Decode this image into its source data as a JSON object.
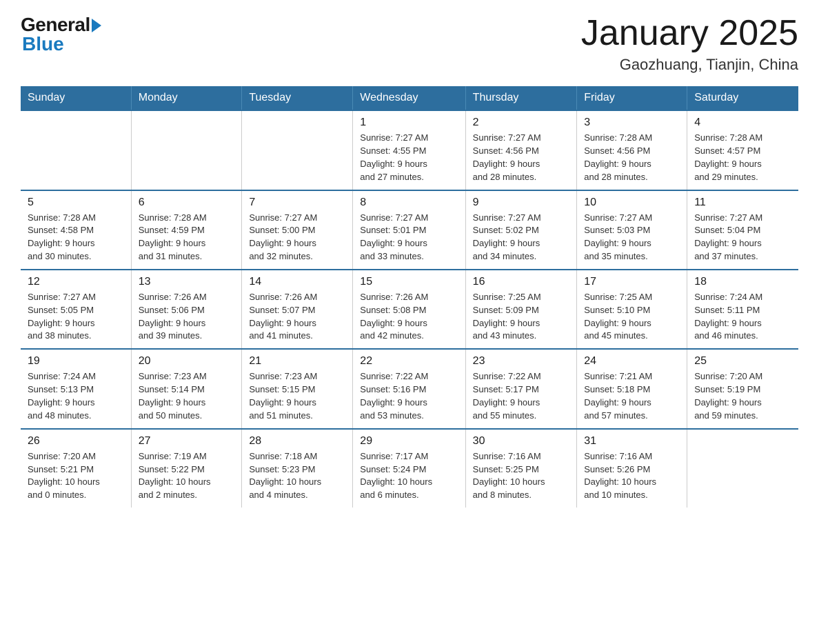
{
  "header": {
    "logo_general": "General",
    "logo_blue": "Blue",
    "month_title": "January 2025",
    "location": "Gaozhuang, Tianjin, China"
  },
  "days_of_week": [
    "Sunday",
    "Monday",
    "Tuesday",
    "Wednesday",
    "Thursday",
    "Friday",
    "Saturday"
  ],
  "weeks": [
    [
      {
        "day": "",
        "info": ""
      },
      {
        "day": "",
        "info": ""
      },
      {
        "day": "",
        "info": ""
      },
      {
        "day": "1",
        "info": "Sunrise: 7:27 AM\nSunset: 4:55 PM\nDaylight: 9 hours\nand 27 minutes."
      },
      {
        "day": "2",
        "info": "Sunrise: 7:27 AM\nSunset: 4:56 PM\nDaylight: 9 hours\nand 28 minutes."
      },
      {
        "day": "3",
        "info": "Sunrise: 7:28 AM\nSunset: 4:56 PM\nDaylight: 9 hours\nand 28 minutes."
      },
      {
        "day": "4",
        "info": "Sunrise: 7:28 AM\nSunset: 4:57 PM\nDaylight: 9 hours\nand 29 minutes."
      }
    ],
    [
      {
        "day": "5",
        "info": "Sunrise: 7:28 AM\nSunset: 4:58 PM\nDaylight: 9 hours\nand 30 minutes."
      },
      {
        "day": "6",
        "info": "Sunrise: 7:28 AM\nSunset: 4:59 PM\nDaylight: 9 hours\nand 31 minutes."
      },
      {
        "day": "7",
        "info": "Sunrise: 7:27 AM\nSunset: 5:00 PM\nDaylight: 9 hours\nand 32 minutes."
      },
      {
        "day": "8",
        "info": "Sunrise: 7:27 AM\nSunset: 5:01 PM\nDaylight: 9 hours\nand 33 minutes."
      },
      {
        "day": "9",
        "info": "Sunrise: 7:27 AM\nSunset: 5:02 PM\nDaylight: 9 hours\nand 34 minutes."
      },
      {
        "day": "10",
        "info": "Sunrise: 7:27 AM\nSunset: 5:03 PM\nDaylight: 9 hours\nand 35 minutes."
      },
      {
        "day": "11",
        "info": "Sunrise: 7:27 AM\nSunset: 5:04 PM\nDaylight: 9 hours\nand 37 minutes."
      }
    ],
    [
      {
        "day": "12",
        "info": "Sunrise: 7:27 AM\nSunset: 5:05 PM\nDaylight: 9 hours\nand 38 minutes."
      },
      {
        "day": "13",
        "info": "Sunrise: 7:26 AM\nSunset: 5:06 PM\nDaylight: 9 hours\nand 39 minutes."
      },
      {
        "day": "14",
        "info": "Sunrise: 7:26 AM\nSunset: 5:07 PM\nDaylight: 9 hours\nand 41 minutes."
      },
      {
        "day": "15",
        "info": "Sunrise: 7:26 AM\nSunset: 5:08 PM\nDaylight: 9 hours\nand 42 minutes."
      },
      {
        "day": "16",
        "info": "Sunrise: 7:25 AM\nSunset: 5:09 PM\nDaylight: 9 hours\nand 43 minutes."
      },
      {
        "day": "17",
        "info": "Sunrise: 7:25 AM\nSunset: 5:10 PM\nDaylight: 9 hours\nand 45 minutes."
      },
      {
        "day": "18",
        "info": "Sunrise: 7:24 AM\nSunset: 5:11 PM\nDaylight: 9 hours\nand 46 minutes."
      }
    ],
    [
      {
        "day": "19",
        "info": "Sunrise: 7:24 AM\nSunset: 5:13 PM\nDaylight: 9 hours\nand 48 minutes."
      },
      {
        "day": "20",
        "info": "Sunrise: 7:23 AM\nSunset: 5:14 PM\nDaylight: 9 hours\nand 50 minutes."
      },
      {
        "day": "21",
        "info": "Sunrise: 7:23 AM\nSunset: 5:15 PM\nDaylight: 9 hours\nand 51 minutes."
      },
      {
        "day": "22",
        "info": "Sunrise: 7:22 AM\nSunset: 5:16 PM\nDaylight: 9 hours\nand 53 minutes."
      },
      {
        "day": "23",
        "info": "Sunrise: 7:22 AM\nSunset: 5:17 PM\nDaylight: 9 hours\nand 55 minutes."
      },
      {
        "day": "24",
        "info": "Sunrise: 7:21 AM\nSunset: 5:18 PM\nDaylight: 9 hours\nand 57 minutes."
      },
      {
        "day": "25",
        "info": "Sunrise: 7:20 AM\nSunset: 5:19 PM\nDaylight: 9 hours\nand 59 minutes."
      }
    ],
    [
      {
        "day": "26",
        "info": "Sunrise: 7:20 AM\nSunset: 5:21 PM\nDaylight: 10 hours\nand 0 minutes."
      },
      {
        "day": "27",
        "info": "Sunrise: 7:19 AM\nSunset: 5:22 PM\nDaylight: 10 hours\nand 2 minutes."
      },
      {
        "day": "28",
        "info": "Sunrise: 7:18 AM\nSunset: 5:23 PM\nDaylight: 10 hours\nand 4 minutes."
      },
      {
        "day": "29",
        "info": "Sunrise: 7:17 AM\nSunset: 5:24 PM\nDaylight: 10 hours\nand 6 minutes."
      },
      {
        "day": "30",
        "info": "Sunrise: 7:16 AM\nSunset: 5:25 PM\nDaylight: 10 hours\nand 8 minutes."
      },
      {
        "day": "31",
        "info": "Sunrise: 7:16 AM\nSunset: 5:26 PM\nDaylight: 10 hours\nand 10 minutes."
      },
      {
        "day": "",
        "info": ""
      }
    ]
  ]
}
